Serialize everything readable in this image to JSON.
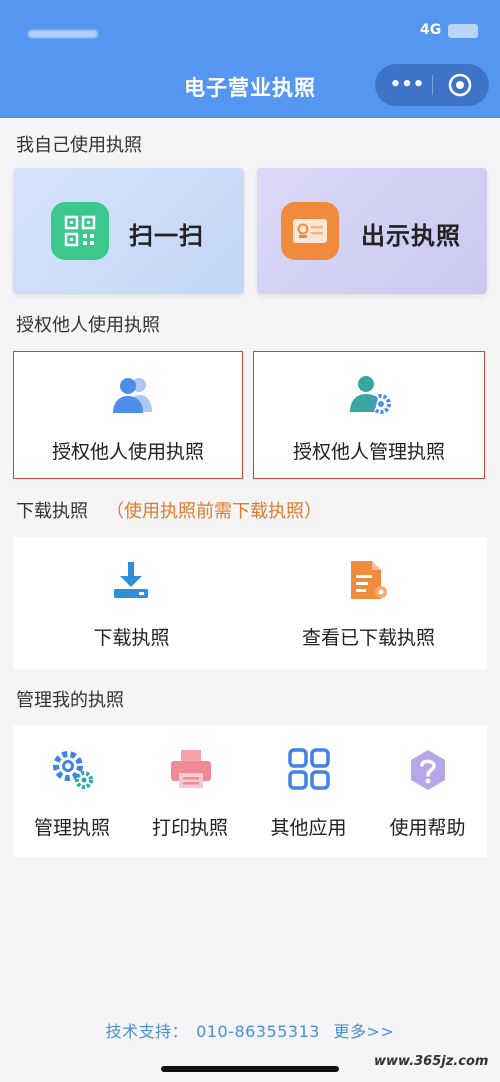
{
  "status_bar": {
    "network": "4G"
  },
  "header": {
    "title": "电子营业执照",
    "more_icon": "more-dots-icon",
    "close_icon": "target-close-icon",
    "color": "#5596f0"
  },
  "sections": {
    "self_use": {
      "title": "我自己使用执照",
      "scan": {
        "label": "扫一扫",
        "icon": "qr-code-icon",
        "icon_color": "#3cc78c"
      },
      "show": {
        "label": "出示执照",
        "icon": "license-card-icon",
        "icon_color": "#f08a3c"
      }
    },
    "authorize": {
      "title": "授权他人使用执照",
      "use": {
        "label": "授权他人使用执照",
        "icon": "users-icon"
      },
      "manage": {
        "label": "授权他人管理执照",
        "icon": "user-settings-icon"
      }
    },
    "download": {
      "title": "下载执照",
      "note": "（使用执照前需下载执照）",
      "download": {
        "label": "下载执照",
        "icon": "download-tray-icon"
      },
      "view": {
        "label": "查看已下载执照",
        "icon": "document-badge-icon"
      }
    },
    "manage": {
      "title": "管理我的执照",
      "items": [
        {
          "label": "管理执照",
          "icon": "gears-icon"
        },
        {
          "label": "打印执照",
          "icon": "printer-icon"
        },
        {
          "label": "其他应用",
          "icon": "apps-grid-icon"
        },
        {
          "label": "使用帮助",
          "icon": "help-question-icon"
        }
      ]
    }
  },
  "footer": {
    "support_label": "技术支持：",
    "phone": "010-86355313",
    "more": "更多>>"
  },
  "watermark": "www.365jz.com"
}
